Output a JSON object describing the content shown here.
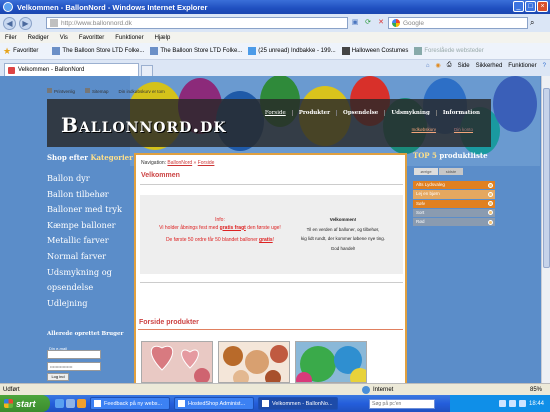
{
  "window": {
    "title": "Velkommen - BallonNord - Windows Internet Explorer"
  },
  "address_bar": {
    "url": "http://www.ballonnord.dk",
    "search_placeholder": "Google"
  },
  "menu": [
    "Filer",
    "Rediger",
    "Vis",
    "Favoritter",
    "Funktioner",
    "Hjælp"
  ],
  "favorites_bar": {
    "label": "Favoritter",
    "items": [
      "The Balloon Store LTD Folke...",
      "The Balloon Store LTD Folke...",
      "(25 unread) Indbakke - 199...",
      "Halloween Costumes",
      "Foreslåede websteder"
    ]
  },
  "tab": {
    "label": "Velkommen - BallonNord"
  },
  "commands": [
    "Side",
    "Sikkerhed",
    "Funktioner"
  ],
  "page": {
    "top_links": [
      "Printvenlig",
      "Sitemap",
      "Din indkøbskurv er tom"
    ],
    "logo": "Ballonnord.dk",
    "main_nav": [
      "Forside",
      "Produkter",
      "Opsendelse",
      "Udsmykning",
      "Information"
    ],
    "sub_nav": [
      "Indkøbskurv",
      "Din konto"
    ],
    "categories_title_prefix": "Shop efter",
    "categories_title_highlight": "Kategorier",
    "categories": [
      "Ballon dyr",
      "Ballon tilbehør",
      "Balloner med tryk",
      "Kæmpe balloner",
      "Metallic farver",
      "Normal farver",
      "Udsmykning og",
      "opsendelse",
      "Udlejning"
    ],
    "login": {
      "title": "Allerede oprettet Bruger",
      "email_label": "Din e-mail",
      "password_value": "••••••••••••••••",
      "button": "Log ind"
    },
    "breadcrumb": {
      "prefix": "Navigation:",
      "items": [
        "BallonNord",
        "Forside"
      ],
      "separator": "»"
    },
    "content_title": "Velkommen",
    "info": {
      "heading": "Info:",
      "line1_prefix": "Vi holder åbnings fest med",
      "line1_bold": "gratis fragt",
      "line1_suffix": "den første uge!",
      "line2_prefix": "De første 50 ordre får 50 blandet balloner",
      "line2_bold": "gratis",
      "line2_suffix": "!"
    },
    "welcome": {
      "heading": "Velkommen!",
      "line1": "Til en verden af balloner, og tilbehør,",
      "line2": "kig lidt rundt, der kommer løbene nye ting.",
      "line3": "God handel!"
    },
    "forside_title": "Forside produkter",
    "top5": {
      "title_prefix": "TOP 5",
      "title_suffix": "produktliste",
      "tabs": [
        "øvrige",
        "sidste"
      ],
      "items": [
        "Alts Lydsvaleg",
        "Lej en bjørn",
        "Sølv",
        "Sort",
        "Rød"
      ]
    }
  },
  "status_bar": {
    "left": "Udført",
    "zone": "Internet",
    "zoom": "85%"
  },
  "taskbar": {
    "start": "start",
    "items": [
      "Feedback på ny webs...",
      "HostedShop Administ...",
      "Velkommen - BallonNo..."
    ],
    "search_placeholder": "Søg på pc'en",
    "time": "18:44"
  },
  "colors": {
    "page_bg": "#5b8dc9",
    "accent_orange": "#e08020",
    "content_border": "#e0a040",
    "link_red": "#c33"
  }
}
